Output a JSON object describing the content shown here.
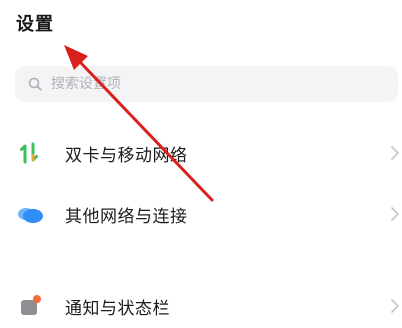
{
  "header": {
    "title": "设置"
  },
  "search": {
    "placeholder": "搜索设置项"
  },
  "settings_items": [
    {
      "label": "双卡与移动网络",
      "icon": "dual-sim-icon"
    },
    {
      "label": "其他网络与连接",
      "icon": "cloud-network-icon"
    },
    {
      "label": "通知与状态栏",
      "icon": "notification-icon"
    }
  ],
  "colors": {
    "annotation_arrow": "#d9201c",
    "dual_sim_green": "#3bbf5a",
    "dual_sim_orange": "#f2a33a",
    "cloud_blue": "#2f8df5",
    "chevron": "#c7c7cc"
  }
}
